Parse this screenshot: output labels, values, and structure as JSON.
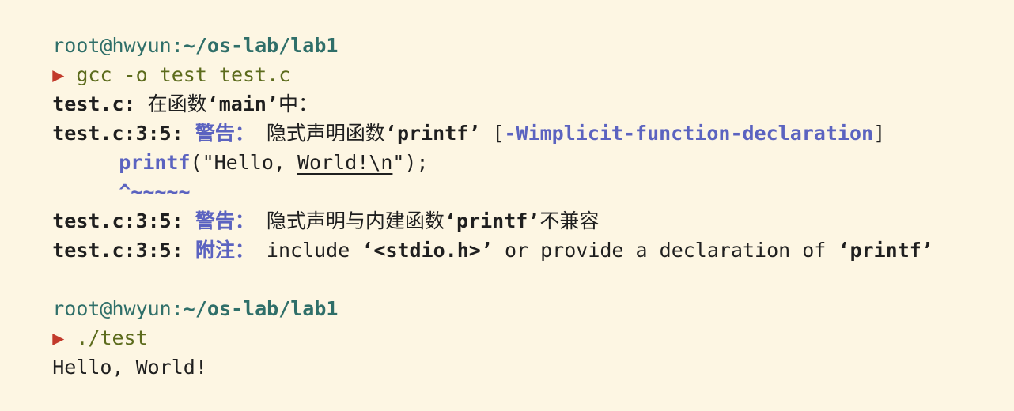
{
  "prompt1": {
    "user": "root@hwyun",
    "sep": ":",
    "path": "~/os-lab/lab1",
    "arrow": "▶",
    "command": "gcc -o test test.c"
  },
  "output": {
    "l1": {
      "file": "test.c:",
      "text_pre": " 在函数",
      "q_open": "‘",
      "name": "main",
      "q_close": "’",
      "text_post": "中："
    },
    "l2": {
      "loc": "test.c:3:5:",
      "kind": " 警告：",
      "text": " 隐式声明函数",
      "q_open": "‘",
      "name": "printf",
      "q_close": "’",
      "flag_open": " [",
      "flag": "-Wimplicit-function-declaration",
      "flag_close": "]"
    },
    "l3": {
      "fn": "printf",
      "args_pre": "(\"Hello, ",
      "args_under": "World!\\n",
      "args_post": "\");"
    },
    "l4": {
      "caret": "^~~~~~"
    },
    "l5": {
      "loc": "test.c:3:5:",
      "kind": " 警告：",
      "text": " 隐式声明与内建函数",
      "q_open": "‘",
      "name": "printf",
      "q_close": "’",
      "text_post": "不兼容"
    },
    "l6": {
      "loc": "test.c:3:5:",
      "kind": " 附注：",
      "text": " include ",
      "q_open": "‘",
      "header": "<stdio.h>",
      "q_close": "’",
      "text_mid": " or provide a declaration of ",
      "q2_open": "‘",
      "name": "printf",
      "q2_close": "’"
    }
  },
  "prompt2": {
    "user": "root@hwyun",
    "sep": ":",
    "path": "~/os-lab/lab1",
    "arrow": "▶",
    "command": "./test"
  },
  "program_output": "Hello, World!"
}
